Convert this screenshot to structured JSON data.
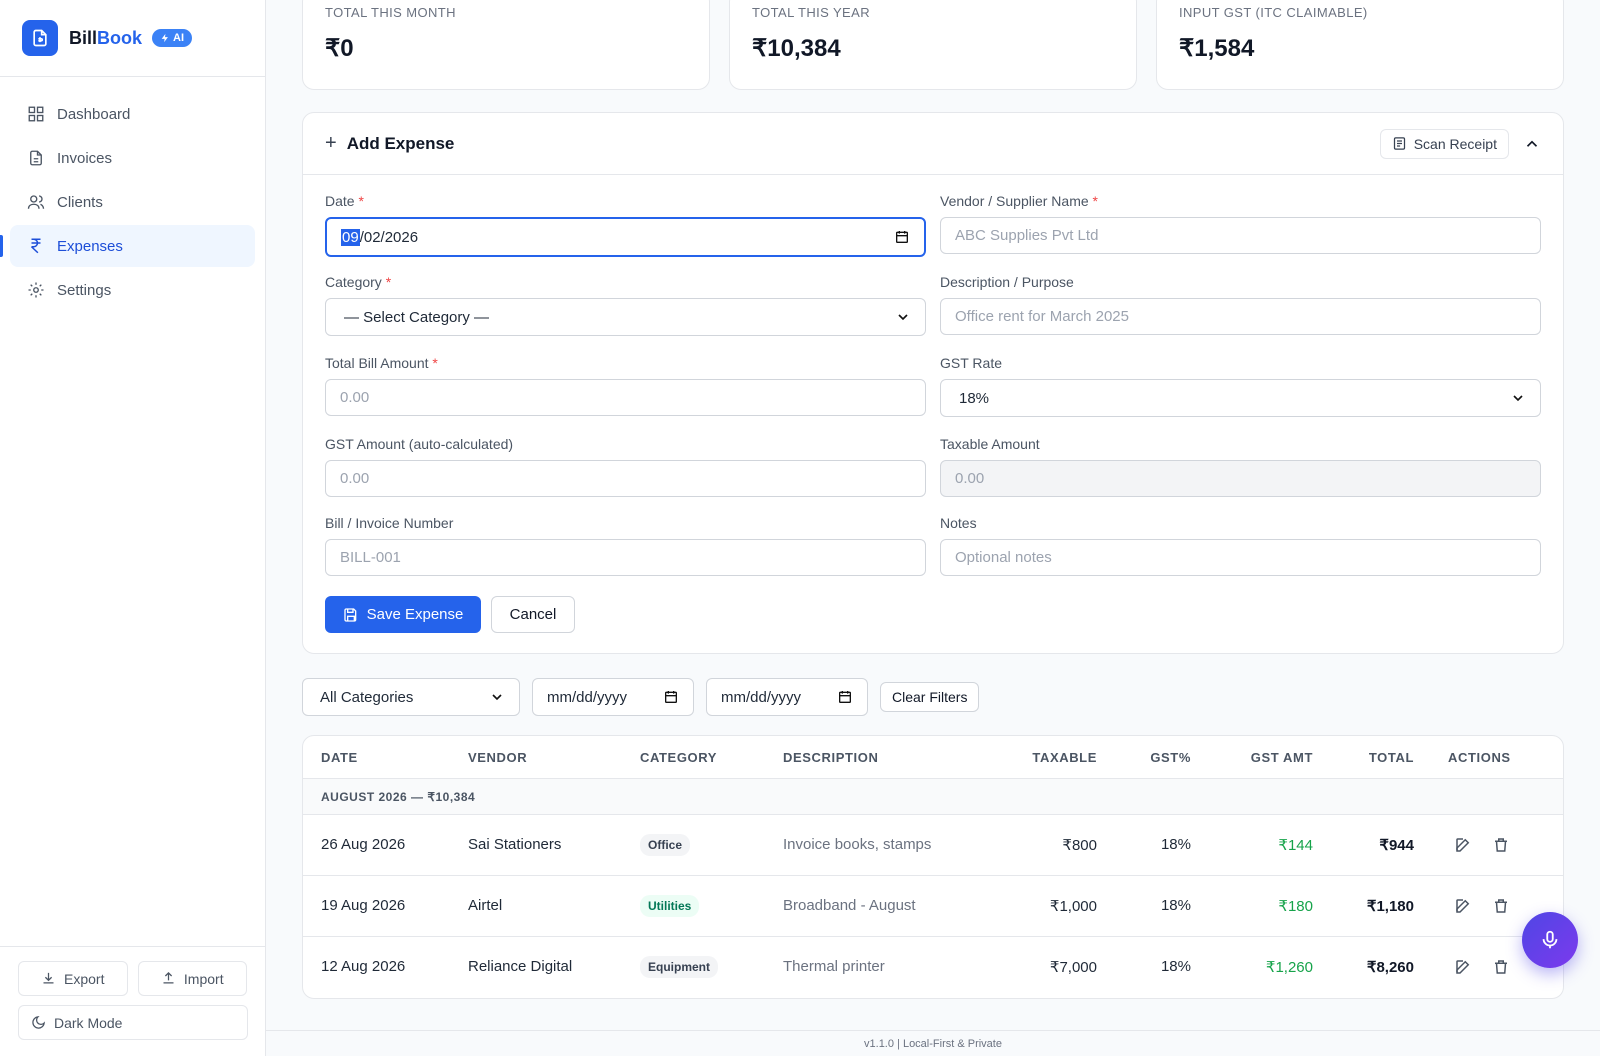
{
  "brand": {
    "name_part1": "Bill",
    "name_part2": "Book",
    "badge": "AI"
  },
  "nav": [
    {
      "label": "Dashboard",
      "icon": "dashboard-icon"
    },
    {
      "label": "Invoices",
      "icon": "invoice-icon"
    },
    {
      "label": "Clients",
      "icon": "users-icon"
    },
    {
      "label": "Expenses",
      "icon": "rupee-icon",
      "active": true
    },
    {
      "label": "Settings",
      "icon": "gear-icon"
    }
  ],
  "sidebar_bottom": {
    "export": "Export",
    "import": "Import",
    "dark_mode": "Dark Mode"
  },
  "stats": [
    {
      "label": "Total This Month",
      "value": "₹0"
    },
    {
      "label": "Total This Year",
      "value": "₹10,384"
    },
    {
      "label": "Input GST (ITC Claimable)",
      "value": "₹1,584"
    }
  ],
  "form": {
    "title": "Add Expense",
    "scan_receipt": "Scan Receipt",
    "date": {
      "label": "Date",
      "value_selected": "09",
      "value_rest": "/02/2026"
    },
    "vendor": {
      "label": "Vendor / Supplier Name",
      "placeholder": "ABC Supplies Pvt Ltd"
    },
    "category": {
      "label": "Category",
      "value": "— Select Category —"
    },
    "description": {
      "label": "Description / Purpose",
      "placeholder": "Office rent for March 2025"
    },
    "total": {
      "label": "Total Bill Amount",
      "placeholder": "0.00"
    },
    "gst_rate": {
      "label": "GST Rate",
      "value": "18%"
    },
    "gst_amount": {
      "label": "GST Amount (auto-calculated)",
      "placeholder": "0.00"
    },
    "taxable": {
      "label": "Taxable Amount",
      "placeholder": "0.00"
    },
    "bill_no": {
      "label": "Bill / Invoice Number",
      "placeholder": "BILL-001"
    },
    "notes": {
      "label": "Notes",
      "placeholder": "Optional notes"
    },
    "save": "Save Expense",
    "cancel": "Cancel",
    "required_mark": "*"
  },
  "filters": {
    "category": "All Categories",
    "from": "mm/dd/yyyy",
    "to": "mm/dd/yyyy",
    "clear": "Clear Filters"
  },
  "table": {
    "headers": [
      "Date",
      "Vendor",
      "Category",
      "Description",
      "Taxable",
      "GST%",
      "GST Amt",
      "Total",
      "Actions"
    ],
    "group": "August 2026 — ₹10,384",
    "rows": [
      {
        "date": "26 Aug 2026",
        "vendor": "Sai Stationers",
        "category": "Office",
        "description": "Invoice books, stamps",
        "taxable": "₹800",
        "gst_pct": "18%",
        "gst_amt": "₹144",
        "total": "₹944"
      },
      {
        "date": "19 Aug 2026",
        "vendor": "Airtel",
        "category": "Utilities",
        "description": "Broadband - August",
        "taxable": "₹1,000",
        "gst_pct": "18%",
        "gst_amt": "₹180",
        "total": "₹1,180"
      },
      {
        "date": "12 Aug 2026",
        "vendor": "Reliance Digital",
        "category": "Equipment",
        "description": "Thermal printer",
        "taxable": "₹7,000",
        "gst_pct": "18%",
        "gst_amt": "₹1,260",
        "total": "₹8,260"
      }
    ]
  },
  "footer": "v1.1.0 | Local-First & Private",
  "colors": {
    "primary": "#2563eb",
    "positive": "#16a34a",
    "mic_gradient_start": "#4f46e5",
    "mic_gradient_end": "#7c3aed"
  }
}
